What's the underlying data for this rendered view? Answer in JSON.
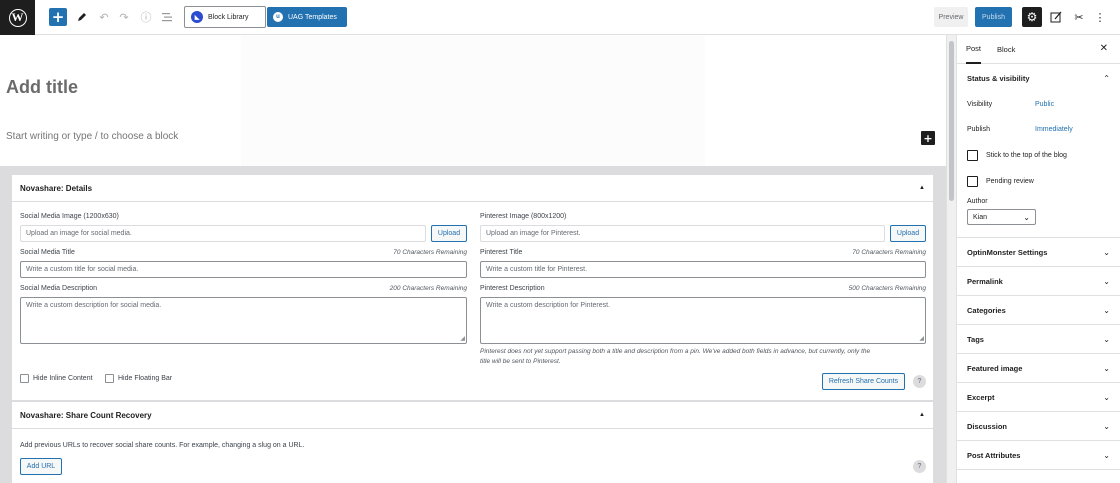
{
  "toolbar": {
    "block_library_label": "Block Library",
    "uag_templates_label": "UAG Templates",
    "preview_label": "Preview",
    "publish_label": "Publish"
  },
  "editor": {
    "title_placeholder": "Add title",
    "block_placeholder": "Start writing or type / to choose a block"
  },
  "novashare_details": {
    "header": "Novashare: Details",
    "social_image_label": "Social Media Image (1200x630)",
    "social_image_placeholder": "Upload an image for social media.",
    "upload_label": "Upload",
    "social_title_label": "Social Media Title",
    "social_title_count": "70 Characters Remaining",
    "social_title_placeholder": "Write a custom title for social media.",
    "social_desc_label": "Social Media Description",
    "social_desc_count": "200 Characters Remaining",
    "social_desc_placeholder": "Write a custom description for social media.",
    "pinterest_image_label": "Pinterest Image (800x1200)",
    "pinterest_image_placeholder": "Upload an image for Pinterest.",
    "pinterest_title_label": "Pinterest Title",
    "pinterest_title_count": "70 Characters Remaining",
    "pinterest_title_placeholder": "Write a custom title for Pinterest.",
    "pinterest_desc_label": "Pinterest Description",
    "pinterest_desc_count": "500 Characters Remaining",
    "pinterest_desc_placeholder": "Write a custom description for Pinterest.",
    "pinterest_note_line1": "Pinterest does not yet support passing both a title and description from a pin. We've added both fields in advance, but currently, only the",
    "pinterest_note_line2": "title will be sent to Pinterest.",
    "hide_inline_label": "Hide Inline Content",
    "hide_floating_label": "Hide Floating Bar",
    "refresh_label": "Refresh Share Counts",
    "help": "?"
  },
  "share_recovery": {
    "header": "Novashare: Share Count Recovery",
    "description": "Add previous URLs to recover social share counts. For example, changing a slug on a URL.",
    "add_url_label": "Add URL",
    "help": "?"
  },
  "sidebar": {
    "tab_post": "Post",
    "tab_block": "Block",
    "status_visibility": {
      "title": "Status & visibility",
      "visibility_label": "Visibility",
      "visibility_value": "Public",
      "publish_label": "Publish",
      "publish_value": "Immediately",
      "sticky_label": "Stick to the top of the blog",
      "pending_label": "Pending review",
      "author_label": "Author",
      "author_value": "Kian"
    },
    "panels": [
      "OptinMonster Settings",
      "Permalink",
      "Categories",
      "Tags",
      "Featured image",
      "Excerpt",
      "Discussion",
      "Post Attributes"
    ]
  }
}
